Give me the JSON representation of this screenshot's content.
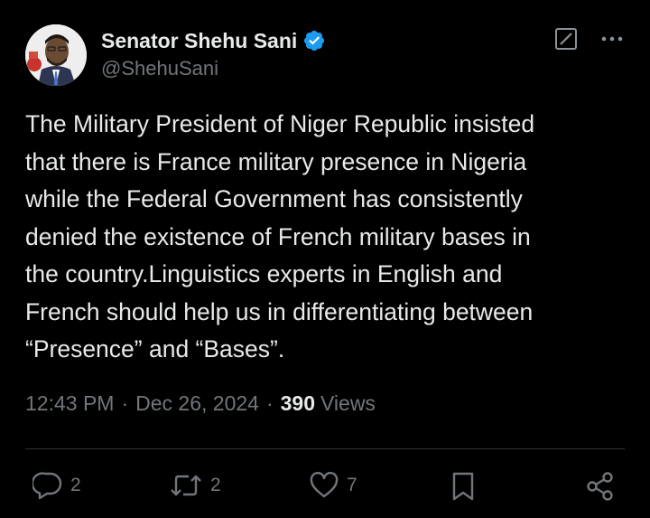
{
  "author": {
    "display_name": "Senator Shehu Sani",
    "handle": "@ShehuSani",
    "verified": true,
    "verified_color": "#1d9bf0"
  },
  "tweet": {
    "text": "The Military President of Niger Republic insisted\nthat there is France military presence in Nigeria\nwhile the Federal Government has consistently\ndenied the existence of French military bases in\nthe country.Linguistics experts in English and\nFrench should help us in differentiating between\n“Presence” and “Bases”."
  },
  "meta": {
    "time": "12:43 PM",
    "separator": "·",
    "date": "Dec 26, 2024",
    "views_count": "390",
    "views_label": "Views"
  },
  "actions": {
    "replies": "2",
    "reposts": "2",
    "likes": "7"
  },
  "icons": {
    "top": [
      "grok-icon",
      "more-icon"
    ],
    "bottom": [
      "reply-icon",
      "repost-icon",
      "like-icon",
      "bookmark-icon",
      "share-icon"
    ]
  },
  "colors": {
    "background": "#000000",
    "text_primary": "#e7e9ea",
    "text_secondary": "#71767b",
    "divider": "#2f3336"
  }
}
